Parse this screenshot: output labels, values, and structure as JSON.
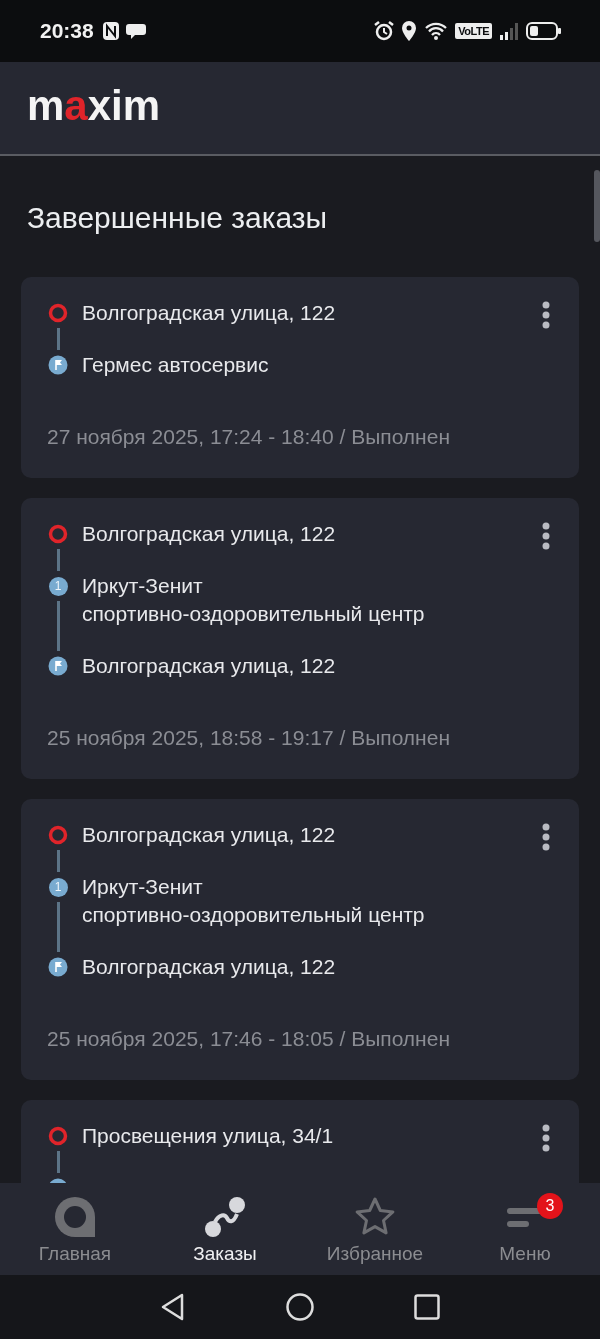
{
  "status_bar": {
    "time": "20:38",
    "network_badge": "VoLTE"
  },
  "header": {
    "logo": [
      {
        "text": "m",
        "accent": false
      },
      {
        "text": "a",
        "accent": true
      },
      {
        "text": "xim",
        "accent": false
      }
    ]
  },
  "title": "Завершенные заказы",
  "orders": [
    {
      "stops": [
        {
          "kind": "origin",
          "address": "Волгоградская улица, 122"
        },
        {
          "kind": "destination",
          "address": "Гермес автосервис"
        }
      ],
      "summary": "27 ноября 2025, 17:24 - 18:40 / Выполнен"
    },
    {
      "stops": [
        {
          "kind": "origin",
          "address": "Волгоградская улица, 122"
        },
        {
          "kind": "waypoint",
          "number": "1",
          "address": "Иркут-Зенит спортивно-оздоровительный центр"
        },
        {
          "kind": "destination",
          "address": "Волгоградская улица, 122"
        }
      ],
      "summary": "25 ноября 2025, 18:58 - 19:17 / Выполнен"
    },
    {
      "stops": [
        {
          "kind": "origin",
          "address": "Волгоградская улица, 122"
        },
        {
          "kind": "waypoint",
          "number": "1",
          "address": "Иркут-Зенит спортивно-оздоровительный центр"
        },
        {
          "kind": "destination",
          "address": "Волгоградская улица, 122"
        }
      ],
      "summary": "25 ноября 2025, 17:46 - 18:05 / Выполнен"
    },
    {
      "stops": [
        {
          "kind": "origin",
          "address": "Просвещения улица, 34/1"
        },
        {
          "kind": "destination"
        }
      ]
    }
  ],
  "bottom_nav": [
    {
      "kind": "home",
      "label": "Главная",
      "selected": false
    },
    {
      "kind": "orders",
      "label": "Заказы",
      "selected": true
    },
    {
      "kind": "favorites",
      "label": "Избранное",
      "selected": false
    },
    {
      "kind": "menu",
      "label": "Меню",
      "selected": false,
      "badge": "3"
    }
  ]
}
